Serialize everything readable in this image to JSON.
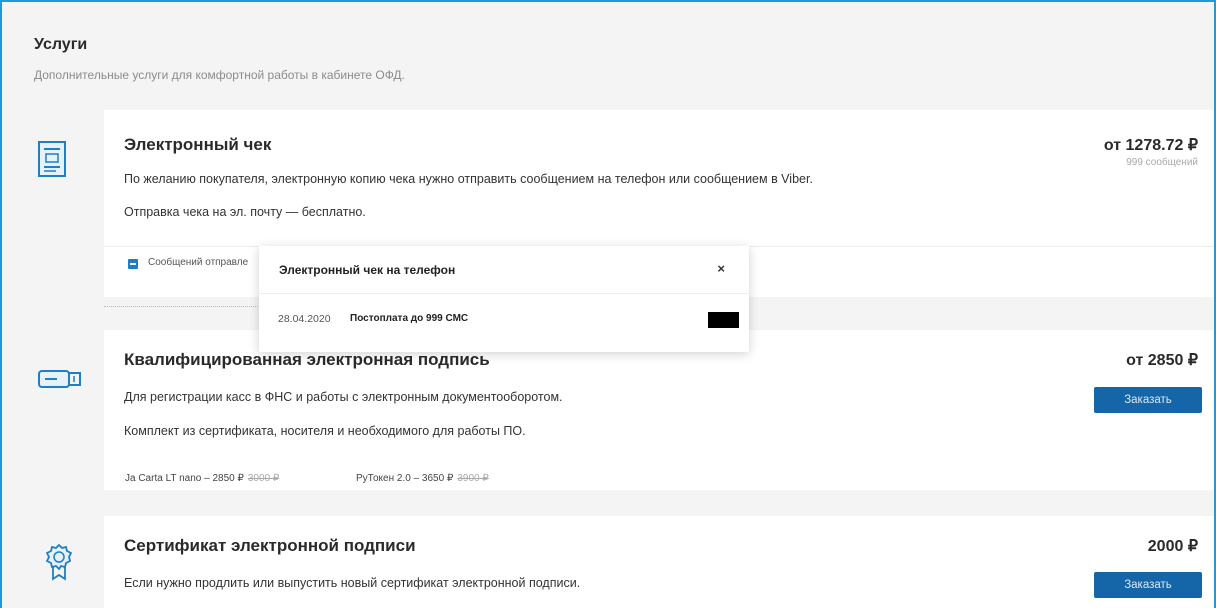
{
  "page": {
    "title": "Услуги",
    "subtitle": "Дополнительные услуги для комфортной работы в кабинете ОФД."
  },
  "services": [
    {
      "title": "Электронный чек",
      "price": "от 1278.72 ₽",
      "price_note": "999 сообщений",
      "lines": [
        "По желанию покупателя, электронную копию чека нужно отправить сообщением на телефон или сообщением в Viber.",
        "Отправка чека на эл. почту — бесплатно."
      ],
      "footer_label": "Сообщений отправле"
    },
    {
      "title": "Квалифицированная электронная подпись",
      "price": "от 2850 ₽",
      "button": "Заказать",
      "lines": [
        "Для регистрации касс в ФНС и работы с электронным документооборотом.",
        "Комплект из сертификата, носителя и необходимого для работы ПО."
      ],
      "variants": [
        {
          "label": "Ja Carta LT nano – 2850 ₽",
          "old": "3000 ₽"
        },
        {
          "label": "РуТокен 2.0 – 3650 ₽",
          "old": "3900 ₽"
        }
      ]
    },
    {
      "title": "Сертификат электронной подписи",
      "price": "2000 ₽",
      "button": "Заказать",
      "lines": [
        "Если нужно продлить или выпустить новый сертификат электронной подписи."
      ]
    }
  ],
  "icons": [
    "receipt-icon",
    "usb-token-icon",
    "certificate-badge-icon",
    "checkbox-icon",
    "close-icon"
  ],
  "modal": {
    "title": "Электронный чек на телефон",
    "close": "×",
    "date": "28.04.2020",
    "plan": "Постоплата до 999 СМС"
  },
  "colors": {
    "accent": "#1e9ad6",
    "button": "#1466a8",
    "icon": "#1e7fc4"
  }
}
